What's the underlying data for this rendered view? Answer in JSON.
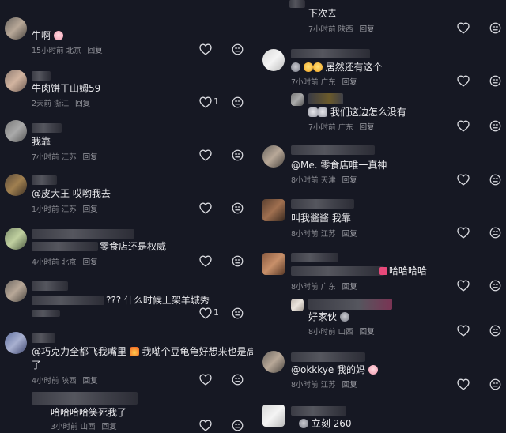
{
  "left": [
    {
      "text": "牛啊",
      "time": "15小时前",
      "loc": "北京",
      "reply": "回复",
      "likes": ""
    },
    {
      "text": "牛肉饼干山姆59",
      "time": "2天前",
      "loc": "浙江",
      "reply": "回复",
      "likes": "1"
    },
    {
      "text": "我靠",
      "time": "7小时前",
      "loc": "江苏",
      "reply": "回复",
      "likes": ""
    },
    {
      "text": "@皮大王  哎哟我去",
      "time": "1小时前",
      "loc": "江苏",
      "reply": "回复",
      "likes": ""
    },
    {
      "text": "零食店还是权威",
      "time": "4小时前",
      "loc": "北京",
      "reply": "回复",
      "likes": ""
    },
    {
      "text": "???  什么时候上架羊城秀",
      "time": "",
      "loc": "",
      "reply": "",
      "likes": "1"
    },
    {
      "text": "@巧克力全都飞我嘴里",
      "text2": "我嘞个豆龟龟好想来也是高端上",
      "text3": "了",
      "time": "4小时前",
      "loc": "陕西",
      "reply": "回复",
      "likes": ""
    },
    {
      "text": "哈哈哈哈笑死我了",
      "time": "3小时前",
      "loc": "山西",
      "reply": "回复",
      "likes": ""
    }
  ],
  "right": [
    {
      "text": "下次去",
      "time": "7小时前",
      "loc": "陕西",
      "reply": "回复"
    },
    {
      "text": "居然还有这个",
      "time": "7小时前",
      "loc": "广东",
      "reply": "回复"
    },
    {
      "text": "我们这边怎么没有",
      "time": "7小时前",
      "loc": "广东",
      "reply": "回复"
    },
    {
      "text": "@Me.  零食店唯一真神",
      "time": "8小时前",
      "loc": "天津",
      "reply": "回复"
    },
    {
      "text": "叫我酱酱 我靠",
      "time": "8小时前",
      "loc": "江苏",
      "reply": "回复"
    },
    {
      "text": "哈哈哈哈",
      "time": "8小时前",
      "loc": "广东",
      "reply": "回复"
    },
    {
      "text": "好家伙",
      "time": "8小时前",
      "loc": "山西",
      "reply": "回复"
    },
    {
      "text": "@okkkye  我的妈",
      "time": "8小时前",
      "loc": "江苏",
      "reply": "回复"
    },
    {
      "text": "立刻 260",
      "time": "",
      "loc": "",
      "reply": ""
    }
  ],
  "icons": {
    "like": "heart-outline-icon",
    "dislike": "dislike-face-icon"
  },
  "colors": {
    "bg": "#161823",
    "text": "#e9e9ec",
    "meta": "#8b8c93"
  }
}
